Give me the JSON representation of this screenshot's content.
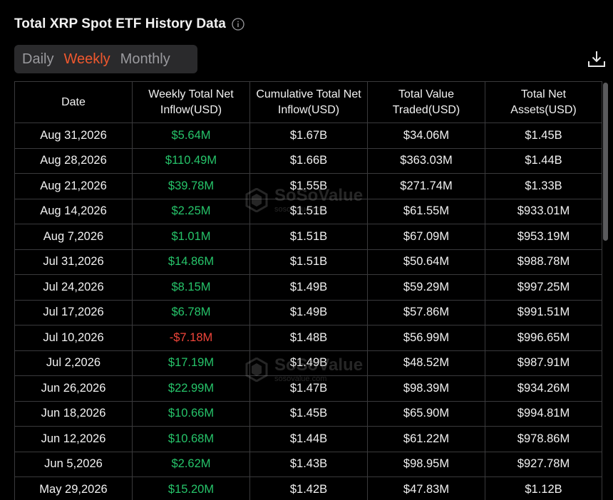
{
  "title": "Total XRP Spot ETF History Data",
  "tabs": [
    {
      "label": "Daily"
    },
    {
      "label": "Weekly"
    },
    {
      "label": "Monthly"
    }
  ],
  "colors": {
    "positive": "#26c46a",
    "negative": "#f0453a",
    "accent": "#f0582e"
  },
  "table": {
    "headers": [
      "Date",
      "Weekly Total Net Inflow(USD)",
      "Cumulative Total Net Inflow(USD)",
      "Total Value Traded(USD)",
      "Total Net Assets(USD)"
    ],
    "rows": [
      {
        "date": "Aug 31,2026",
        "inflow": "$5.64M",
        "cumulative": "$1.67B",
        "traded": "$34.06M",
        "assets": "$1.45B"
      },
      {
        "date": "Aug 28,2026",
        "inflow": "$110.49M",
        "cumulative": "$1.66B",
        "traded": "$363.03M",
        "assets": "$1.44B"
      },
      {
        "date": "Aug 21,2026",
        "inflow": "$39.78M",
        "cumulative": "$1.55B",
        "traded": "$271.74M",
        "assets": "$1.33B"
      },
      {
        "date": "Aug 14,2026",
        "inflow": "$2.25M",
        "cumulative": "$1.51B",
        "traded": "$61.55M",
        "assets": "$933.01M"
      },
      {
        "date": "Aug 7,2026",
        "inflow": "$1.01M",
        "cumulative": "$1.51B",
        "traded": "$67.09M",
        "assets": "$953.19M"
      },
      {
        "date": "Jul 31,2026",
        "inflow": "$14.86M",
        "cumulative": "$1.51B",
        "traded": "$50.64M",
        "assets": "$988.78M"
      },
      {
        "date": "Jul 24,2026",
        "inflow": "$8.15M",
        "cumulative": "$1.49B",
        "traded": "$59.29M",
        "assets": "$997.25M"
      },
      {
        "date": "Jul 17,2026",
        "inflow": "$6.78M",
        "cumulative": "$1.49B",
        "traded": "$57.86M",
        "assets": "$991.51M"
      },
      {
        "date": "Jul 10,2026",
        "inflow": "-$7.18M",
        "cumulative": "$1.48B",
        "traded": "$56.99M",
        "assets": "$996.65M"
      },
      {
        "date": "Jul 2,2026",
        "inflow": "$17.19M",
        "cumulative": "$1.49B",
        "traded": "$48.52M",
        "assets": "$987.91M"
      },
      {
        "date": "Jun 26,2026",
        "inflow": "$22.99M",
        "cumulative": "$1.47B",
        "traded": "$98.39M",
        "assets": "$934.26M"
      },
      {
        "date": "Jun 18,2026",
        "inflow": "$10.66M",
        "cumulative": "$1.45B",
        "traded": "$65.90M",
        "assets": "$994.81M"
      },
      {
        "date": "Jun 12,2026",
        "inflow": "$10.68M",
        "cumulative": "$1.44B",
        "traded": "$61.22M",
        "assets": "$978.86M"
      },
      {
        "date": "Jun 5,2026",
        "inflow": "$2.62M",
        "cumulative": "$1.43B",
        "traded": "$98.95M",
        "assets": "$927.78M"
      },
      {
        "date": "May 29,2026",
        "inflow": "$15.20M",
        "cumulative": "$1.42B",
        "traded": "$47.83M",
        "assets": "$1.12B"
      }
    ]
  },
  "watermark": {
    "brand": "SoSoValue",
    "url": "sosovalue.com"
  }
}
